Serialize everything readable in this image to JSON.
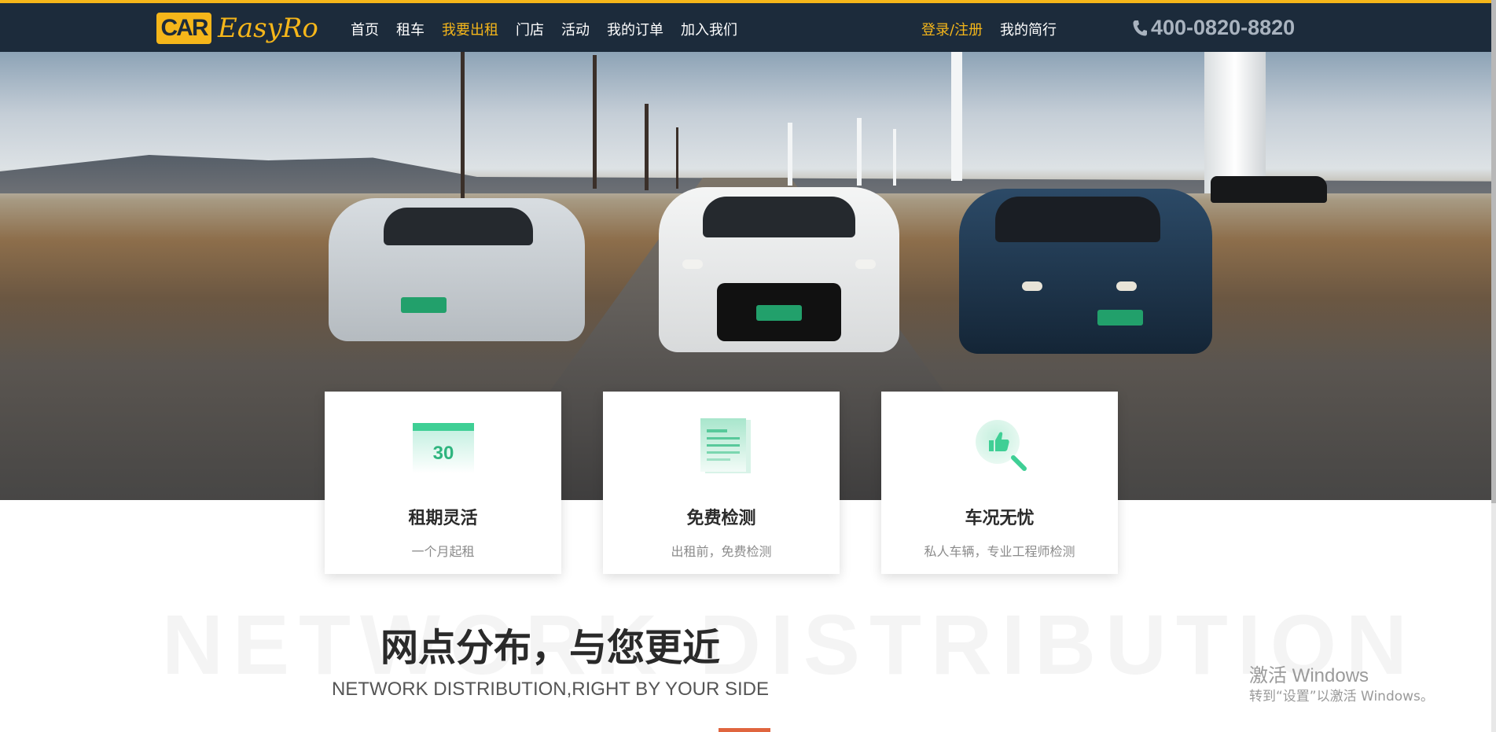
{
  "header": {
    "logo_box": "CAR",
    "logo_text": "EasyRo",
    "nav": [
      {
        "label": "首页",
        "active": false
      },
      {
        "label": "租车",
        "active": false
      },
      {
        "label": "我要出租",
        "active": true
      },
      {
        "label": "门店",
        "active": false
      },
      {
        "label": "活动",
        "active": false
      },
      {
        "label": "我的订单",
        "active": false
      },
      {
        "label": "加入我们",
        "active": false
      }
    ],
    "login": "登录/注册",
    "resume": "我的简行",
    "phone": "400-0820-8820",
    "phone_icon": "phone-icon"
  },
  "hero": {
    "image": "three-cars-on-gravel-road"
  },
  "features": [
    {
      "icon": "calendar-icon",
      "icon_text": "30",
      "title": "租期灵活",
      "subtitle": "一个月起租"
    },
    {
      "icon": "document-icon",
      "title": "免费检测",
      "subtitle": "出租前，免费检测"
    },
    {
      "icon": "thumbs-up-search-icon",
      "title": "车况无忧",
      "subtitle": "私人车辆，专业工程师检测"
    }
  ],
  "section": {
    "background_word": "NETWORK DISTRIBUTION",
    "title": "网点分布，与您更近",
    "subtitle": "NETWORK DISTRIBUTION,RIGHT BY YOUR SIDE"
  },
  "watermark": {
    "line1": "激活 Windows",
    "line2": "转到“设置”以激活 Windows。"
  },
  "colors": {
    "header_bg": "#1c2b3b",
    "accent": "#f5b61a",
    "icon_green": "#3fcf95",
    "section_bar": "#e0653f"
  }
}
